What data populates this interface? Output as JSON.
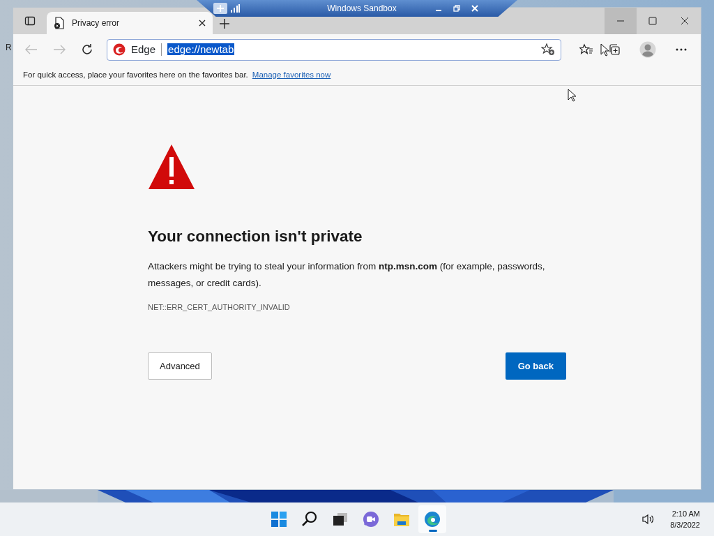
{
  "desktop": {
    "icon_label": "R"
  },
  "connection_bar": {
    "title": "Windows Sandbox"
  },
  "browser": {
    "tabs": [
      {
        "title": "Privacy error",
        "selected": true
      }
    ],
    "address_bar": {
      "site_label": "Edge",
      "url": "edge://newtab",
      "url_selected": true
    },
    "favorites_bar": {
      "message": "For quick access, place your favorites here on the favorites bar.",
      "link": "Manage favorites now"
    },
    "error_page": {
      "heading": "Your connection isn't private",
      "message": "Attackers might be trying to steal your information from **ntp.msn.com** (for example, passwords, messages, or credit cards).",
      "error_code": "NET::ERR_CERT_AUTHORITY_INVALID",
      "buttons": [
        {
          "label": "Advanced",
          "kind": "secondary"
        },
        {
          "label": "Go back",
          "kind": "primary"
        }
      ]
    }
  },
  "taskbar": {
    "apps": [
      {
        "kind": "start",
        "active": false
      },
      {
        "kind": "search",
        "active": false
      },
      {
        "kind": "taskview",
        "active": false
      },
      {
        "kind": "chat",
        "active": false
      },
      {
        "kind": "explorer",
        "active": false
      },
      {
        "kind": "edge",
        "active": true
      }
    ],
    "time": "2:10 AM",
    "date": "8/3/2022"
  }
}
